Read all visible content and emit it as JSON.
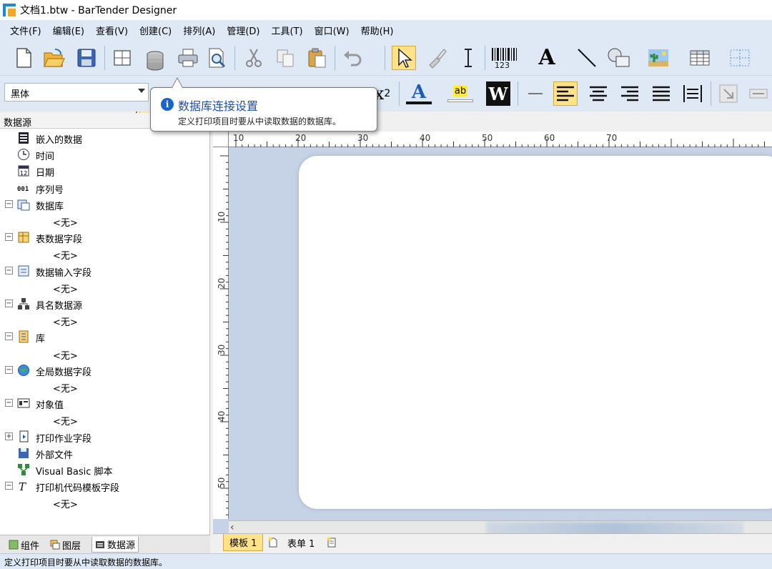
{
  "window": {
    "title": "文档1.btw - BarTender Designer"
  },
  "menu": [
    "文件(F)",
    "编辑(E)",
    "查看(V)",
    "创建(C)",
    "排列(A)",
    "管理(D)",
    "工具(T)",
    "窗口(W)",
    "帮助(H)"
  ],
  "toolbar": {
    "font_name": "黑体",
    "barcode_digits": "123",
    "superscript_text": "x",
    "superscript_exp": "2",
    "text_tool": "A",
    "highlight_text": "ab",
    "word_art": "W"
  },
  "tooltip": {
    "title": "数据库连接设置",
    "body": "定义打印项目时要从中读取数据的数据库。"
  },
  "datasource_panel": {
    "header": "数据源",
    "none_label": "<无>",
    "items": [
      {
        "label": "嵌入的数据",
        "icon": "embedded-data-icon",
        "expander": ""
      },
      {
        "label": "时间",
        "icon": "clock-icon",
        "expander": ""
      },
      {
        "label": "日期",
        "icon": "calendar-icon",
        "expander": ""
      },
      {
        "label": "序列号",
        "icon": "serial-number-icon",
        "expander": ""
      },
      {
        "label": "数据库",
        "icon": "database-fields-icon",
        "expander": "⊟"
      },
      {
        "label": "表数据字段",
        "icon": "table-fields-icon",
        "expander": "⊟"
      },
      {
        "label": "数据输入字段",
        "icon": "data-entry-icon",
        "expander": "⊟"
      },
      {
        "label": "具名数据源",
        "icon": "named-source-icon",
        "expander": "⊟"
      },
      {
        "label": "库",
        "icon": "library-icon",
        "expander": "⊟"
      },
      {
        "label": "全局数据字段",
        "icon": "globe-icon",
        "expander": "⊟"
      },
      {
        "label": "对象值",
        "icon": "object-value-icon",
        "expander": "⊟"
      },
      {
        "label": "打印作业字段",
        "icon": "print-job-icon",
        "expander": "⊞"
      },
      {
        "label": "外部文件",
        "icon": "floppy-icon",
        "expander": ""
      },
      {
        "label": "Visual Basic 脚本",
        "icon": "vb-script-icon",
        "expander": ""
      },
      {
        "label": "打印机代码模板字段",
        "icon": "printer-code-icon",
        "expander": "⊟"
      }
    ],
    "bottom_tabs": [
      "组件",
      "图层",
      "数据源"
    ]
  },
  "ruler": {
    "h_labels": [
      "10",
      "20",
      "30",
      "40",
      "50",
      "60",
      "70"
    ],
    "v_labels": [
      "10",
      "20",
      "30",
      "40",
      "50"
    ]
  },
  "doc_tabs": [
    "模板 1",
    "表单 1"
  ],
  "status": "定义打印项目时要从中读取数据的数据库。"
}
